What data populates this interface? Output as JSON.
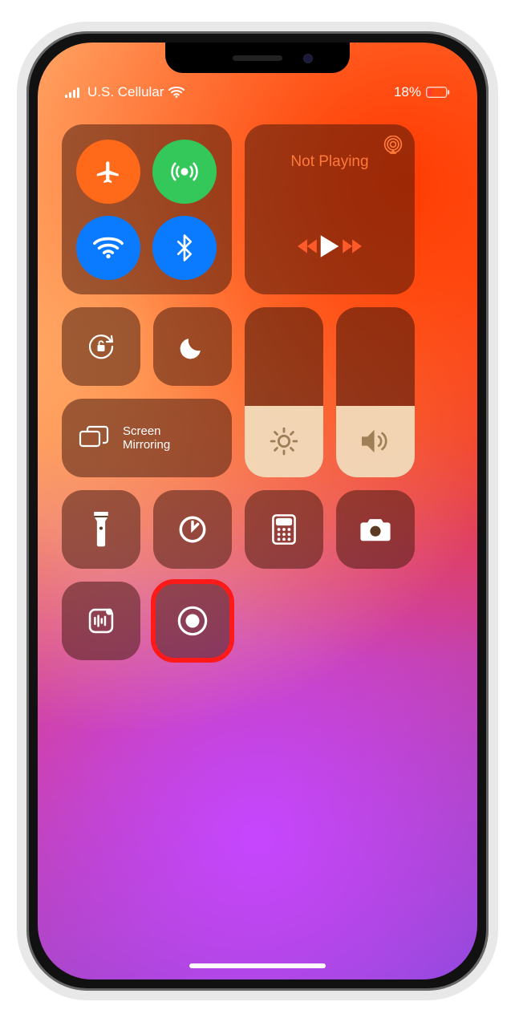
{
  "status": {
    "carrier": "U.S. Cellular",
    "battery_text": "18%",
    "battery_pct": 18,
    "signal_bars": 4,
    "wifi": true
  },
  "connectivity": {
    "airplane": {
      "on": false,
      "color": "#ff6a1a"
    },
    "cellular": {
      "on": true,
      "color": "#34c759"
    },
    "wifi": {
      "on": true,
      "color": "#0a7bff"
    },
    "bluetooth": {
      "on": true,
      "color": "#0a7bff"
    }
  },
  "media": {
    "title": "Not Playing",
    "state": "paused",
    "airplay_available": true
  },
  "orientation_lock": {
    "locked": false
  },
  "dnd": {
    "on": false
  },
  "screen_mirroring": {
    "label": "Screen\nMirroring"
  },
  "sliders": {
    "brightness": {
      "value_pct": 42
    },
    "volume": {
      "value_pct": 42
    }
  },
  "quick": {
    "flashlight": "flashlight-icon",
    "timer": "timer-icon",
    "calculator": "calculator-icon",
    "camera": "camera-icon",
    "code_scanner": "code-scanner-icon",
    "screen_record": "screen-record-icon"
  },
  "highlight_target": "screen-record-button"
}
